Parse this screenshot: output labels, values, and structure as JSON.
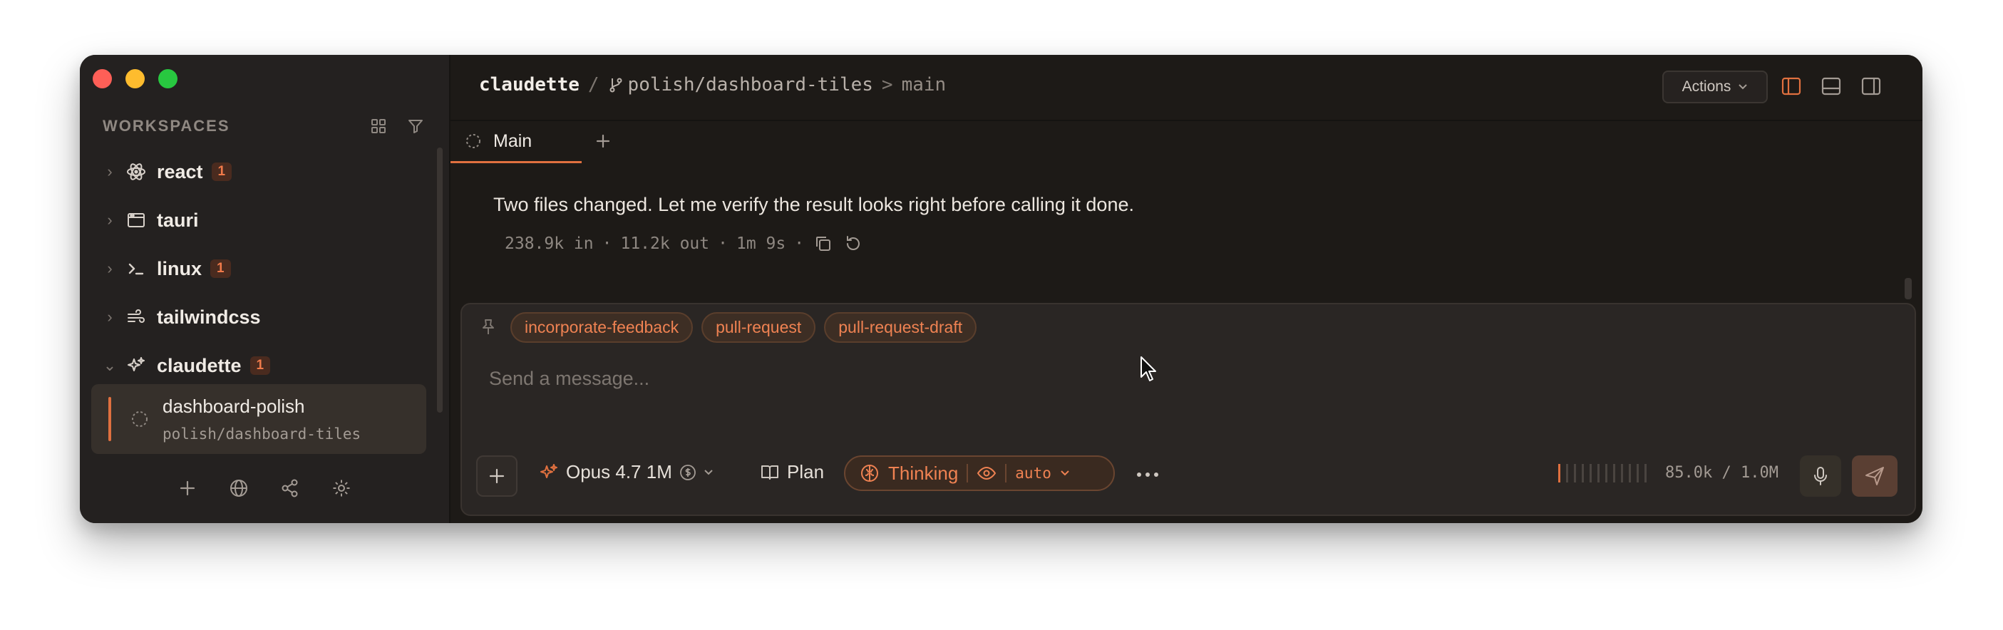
{
  "sidebar": {
    "title": "WORKSPACES",
    "items": [
      {
        "label": "react",
        "badge": "1",
        "icon": "atom-icon"
      },
      {
        "label": "tauri",
        "badge": "",
        "icon": "window-icon"
      },
      {
        "label": "linux",
        "badge": "1",
        "icon": "terminal-icon"
      },
      {
        "label": "tailwindcss",
        "badge": "",
        "icon": "wind-icon"
      },
      {
        "label": "claudette",
        "badge": "1",
        "icon": "sparkles-icon"
      }
    ],
    "active_workspace": {
      "name": "dashboard-polish",
      "branch": "polish/dashboard-tiles"
    }
  },
  "header": {
    "repo": "claudette",
    "separator": "/",
    "branch": "polish/dashboard-tiles",
    "arrow": ">",
    "target": "main",
    "actions_label": "Actions"
  },
  "tabs": [
    {
      "label": "Main",
      "active": true
    }
  ],
  "conversation": {
    "message": "Two files changed. Let me verify the result looks right before calling it done.",
    "tokens_in": "238.9k in",
    "tokens_out": "11.2k out",
    "duration": "1m 9s",
    "dot": "·"
  },
  "composer": {
    "chips": [
      "incorporate-feedback",
      "pull-request",
      "pull-request-draft"
    ],
    "placeholder": "Send a message...",
    "model": "Opus 4.7 1M",
    "plan_label": "Plan",
    "thinking_label": "Thinking",
    "effort": "auto",
    "context_usage": "85.0k / 1.0M",
    "context_fill_fraction": 0.085
  },
  "colors": {
    "accent": "#e0703f",
    "window_bg": "#1d1a17",
    "sidebar_bg": "#242120",
    "composer_bg": "#2a2624"
  }
}
